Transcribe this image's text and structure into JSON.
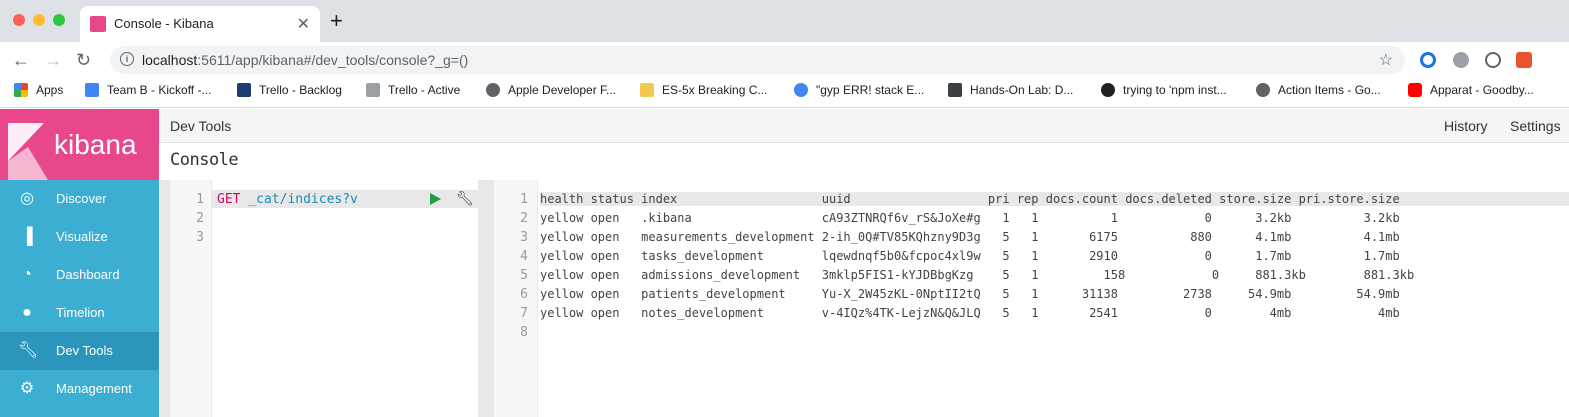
{
  "browser": {
    "tab_title": "Console - Kibana",
    "url_host": "localhost",
    "url_rest": ":5611/app/kibana#/dev_tools/console?_g=()",
    "bookmarks": [
      {
        "label": "Apps",
        "color": "#ea4335"
      },
      {
        "label": "Team B - Kickoff -...",
        "color": "#4285f4"
      },
      {
        "label": "Trello - Backlog",
        "color": "#1a3e72"
      },
      {
        "label": "Trello - Active",
        "color": "#9aa0a6"
      },
      {
        "label": "Apple Developer F...",
        "color": "#5f6368"
      },
      {
        "label": "ES-5x Breaking C...",
        "color": "#f2c94c"
      },
      {
        "label": "\"gyp ERR! stack E...",
        "color": "#4285f4"
      },
      {
        "label": "Hands-On Lab: D...",
        "color": "#3c4043"
      },
      {
        "label": "trying to 'npm inst...",
        "color": "#202124"
      },
      {
        "label": "Action Items - Go...",
        "color": "#5f6368"
      },
      {
        "label": "Apparat - Goodby...",
        "color": "#ff0000"
      }
    ]
  },
  "kibana": {
    "logo": "kibana",
    "nav": [
      {
        "label": "Discover",
        "icon": "compass-icon"
      },
      {
        "label": "Visualize",
        "icon": "bar-chart-icon"
      },
      {
        "label": "Dashboard",
        "icon": "dashboard-icon"
      },
      {
        "label": "Timelion",
        "icon": "timelion-icon"
      },
      {
        "label": "Dev Tools",
        "icon": "wrench-icon"
      },
      {
        "label": "Management",
        "icon": "gear-icon"
      }
    ],
    "topbar": {
      "title": "Dev Tools",
      "history": "History",
      "settings": "Settings"
    },
    "console_tab": "Console",
    "request": {
      "method": "GET",
      "path": "_cat/indices?v"
    },
    "request_line_numbers": [
      "1",
      "2",
      "3"
    ],
    "response_line_numbers": [
      "1",
      "2",
      "3",
      "4",
      "5",
      "6",
      "7",
      "8"
    ],
    "response_lines": [
      "health status index                    uuid                   pri rep docs.count docs.deleted store.size pri.store.size",
      "yellow open   .kibana                  cA93ZTNRQf6v_rS&JoXe#g   1   1          1            0      3.2kb          3.2kb",
      "yellow open   measurements_development 2-ih_0Q#TV85KQhzny9D3g   5   1       6175          880      4.1mb          4.1mb",
      "yellow open   tasks_development        lqewdnqf5b0&fcpoc4xl9w   5   1       2910            0      1.7mb          1.7mb",
      "yellow open   admissions_development   3mklp5FIS1-kYJDBbgKzg    5   1         158            0     881.3kb        881.3kb",
      "yellow open   patients_development     Yu-X_2W45zKL-0NptII2tQ   5   1      31138         2738     54.9mb         54.9mb",
      "yellow open   notes_development        v-4IQz%4TK-LejzN&Q&JLQ   5   1       2541            0        4mb            4mb",
      ""
    ]
  }
}
